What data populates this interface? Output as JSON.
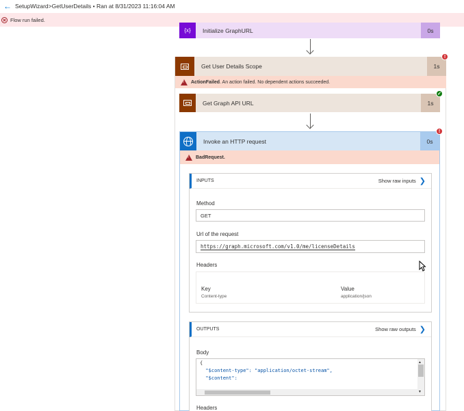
{
  "header": {
    "breadcrumb": "SetupWizard>GetUserDetails • Ran at 8/31/2023 11:16:04 AM",
    "error_message": "Flow run failed."
  },
  "icons": {
    "back": "back-arrow-icon",
    "error": "error-circle-icon",
    "warning": "warning-triangle-icon",
    "variable": "variable-icon",
    "scope": "scope-icon",
    "http": "globe-icon"
  },
  "steps": {
    "init": {
      "title": "Initialize GraphURL",
      "icon_text": "{x}",
      "duration": "0s"
    },
    "scope": {
      "title": "Get User Details Scope",
      "duration": "1s",
      "status": "failed",
      "warning_bold": "ActionFailed",
      "warning_text": ". An action failed. No dependent actions succeeded."
    },
    "get_url": {
      "title": "Get Graph API URL",
      "duration": "1s",
      "status": "succeeded"
    },
    "http": {
      "title": "Invoke an HTTP request",
      "duration": "0s",
      "status": "failed",
      "warning_bold": "BadRequest",
      "warning_text": "."
    }
  },
  "inputs": {
    "heading": "INPUTS",
    "raw_label": "Show raw inputs",
    "method_label": "Method",
    "method_value": "GET",
    "url_label": "Url of the request",
    "url_value": "https://graph.microsoft.com/v1.0/me/licenseDetails",
    "headers_label": "Headers",
    "headers_table": {
      "columns": [
        "Key",
        "Value"
      ],
      "rows": [
        [
          "Content-type",
          "application/json"
        ]
      ]
    }
  },
  "outputs": {
    "heading": "OUTPUTS",
    "raw_label": "Show raw outputs",
    "body_label": "Body",
    "body_lines": [
      "{",
      "  \"$content-type\": \"application/octet-stream\",",
      "  \"$content\":"
    ],
    "headers_label": "Headers"
  },
  "colors": {
    "accent": "#0f6fc6",
    "error": "#d13438",
    "success": "#107c10",
    "scope_brown": "#8c3900",
    "variable_purple": "#770bd6"
  }
}
